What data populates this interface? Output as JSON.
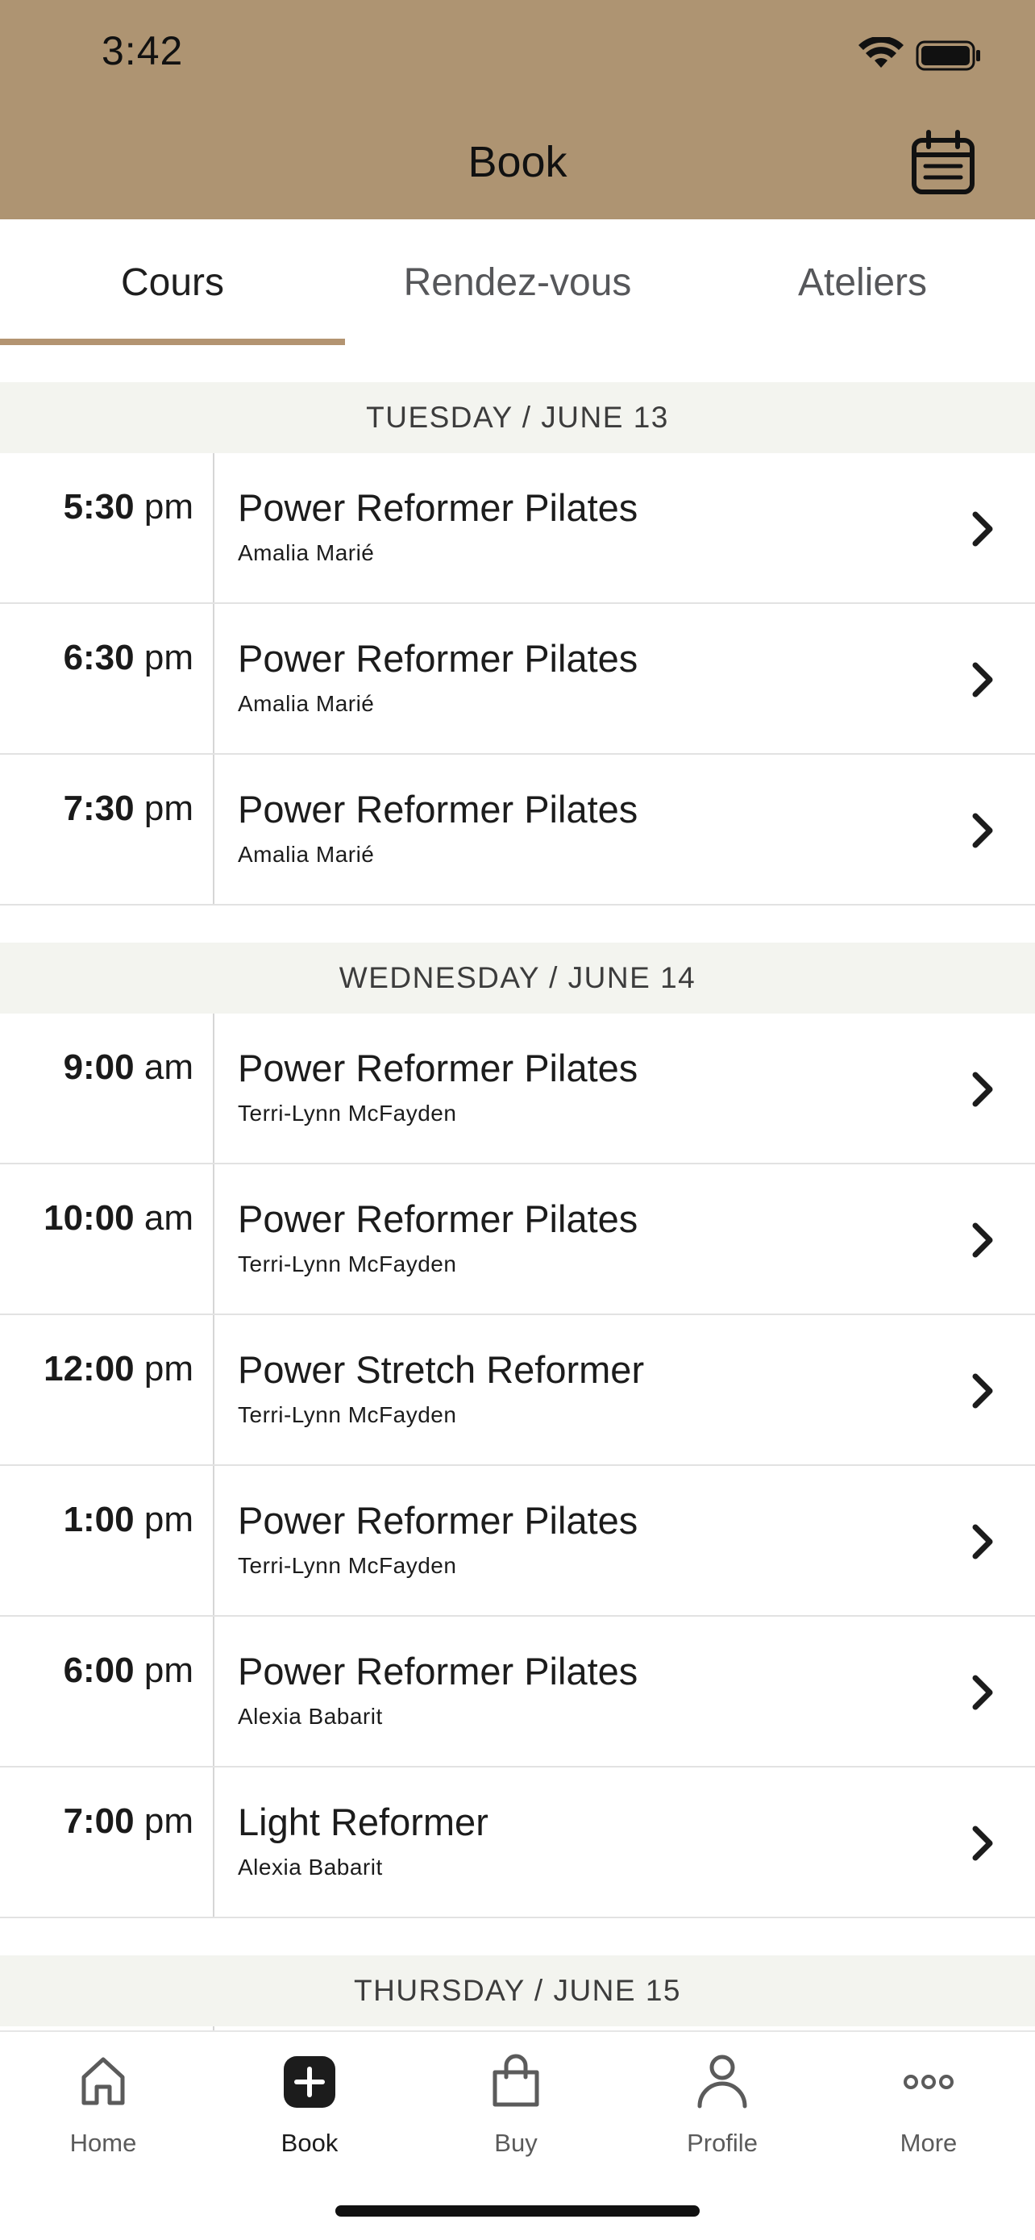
{
  "status_bar": {
    "time": "3:42"
  },
  "header": {
    "title": "Book",
    "calendar_icon": "calendar-icon"
  },
  "tabs": [
    {
      "label": "Cours",
      "active": true
    },
    {
      "label": "Rendez-vous",
      "active": false
    },
    {
      "label": "Ateliers",
      "active": false
    }
  ],
  "days": [
    {
      "header": "TUESDAY / JUNE 13",
      "classes": [
        {
          "time_bold": "5:30",
          "time_suffix": "pm",
          "name": "Power Reformer Pilates",
          "instructor": "Amalia Marié"
        },
        {
          "time_bold": "6:30",
          "time_suffix": "pm",
          "name": "Power Reformer Pilates",
          "instructor": "Amalia Marié"
        },
        {
          "time_bold": "7:30",
          "time_suffix": "pm",
          "name": "Power Reformer Pilates",
          "instructor": "Amalia Marié"
        }
      ]
    },
    {
      "header": "WEDNESDAY / JUNE 14",
      "classes": [
        {
          "time_bold": "9:00",
          "time_suffix": "am",
          "name": "Power Reformer Pilates",
          "instructor": "Terri-Lynn McFayden"
        },
        {
          "time_bold": "10:00",
          "time_suffix": "am",
          "name": "Power Reformer Pilates",
          "instructor": "Terri-Lynn McFayden"
        },
        {
          "time_bold": "12:00",
          "time_suffix": "pm",
          "name": "Power Stretch Reformer",
          "instructor": "Terri-Lynn McFayden"
        },
        {
          "time_bold": "1:00",
          "time_suffix": "pm",
          "name": "Power Reformer Pilates",
          "instructor": "Terri-Lynn McFayden"
        },
        {
          "time_bold": "6:00",
          "time_suffix": "pm",
          "name": "Power Reformer Pilates",
          "instructor": "Alexia Babarit"
        },
        {
          "time_bold": "7:00",
          "time_suffix": "pm",
          "name": "Light Reformer",
          "instructor": "Alexia Babarit"
        }
      ]
    },
    {
      "header": "THURSDAY / JUNE 15",
      "classes": []
    }
  ],
  "bottom_nav": [
    {
      "label": "Home",
      "icon": "home-icon",
      "active": false
    },
    {
      "label": "Book",
      "icon": "plus-square-icon",
      "active": true
    },
    {
      "label": "Buy",
      "icon": "shopping-bag-icon",
      "active": false
    },
    {
      "label": "Profile",
      "icon": "person-icon",
      "active": false
    },
    {
      "label": "More",
      "icon": "more-dots-icon",
      "active": false
    }
  ],
  "colors": {
    "header_bg": "#ae9472",
    "tab_underline": "#b39471",
    "day_header_bg": "#f3f4ef"
  }
}
